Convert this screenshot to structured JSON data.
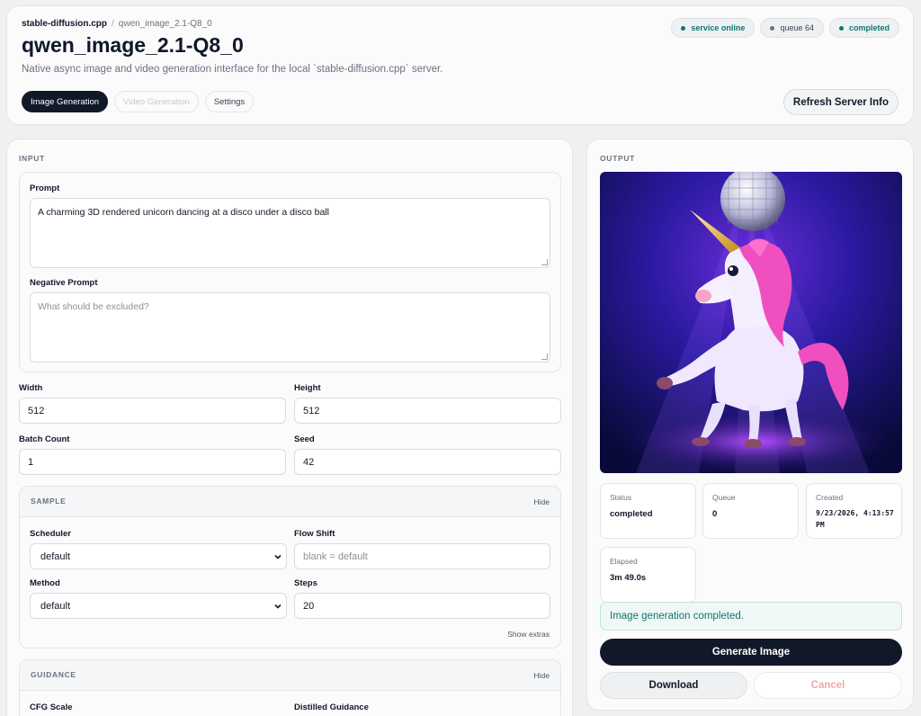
{
  "breadcrumb": {
    "project": "stable-diffusion.cpp",
    "model": "qwen_image_2.1-Q8_0"
  },
  "header": {
    "title": "qwen_image_2.1-Q8_0",
    "subtitle": "Native async image and video generation interface for the local `stable-diffusion.cpp` server.",
    "refresh_label": "Refresh Server Info"
  },
  "badges": [
    {
      "label": "service online",
      "dot_color": "#0f766e"
    },
    {
      "label": "queue 64",
      "dot_color": "#6b7280"
    },
    {
      "label": "completed",
      "dot_color": "#0f766e"
    }
  ],
  "tabs": [
    {
      "label": "Image Generation",
      "state": "active"
    },
    {
      "label": "Video Generation",
      "state": "disabled"
    },
    {
      "label": "Settings",
      "state": "normal"
    }
  ],
  "input": {
    "section_label": "INPUT",
    "prompt_label": "Prompt",
    "prompt_value": "A charming 3D rendered unicorn dancing at a disco under a disco ball",
    "negative_label": "Negative Prompt",
    "negative_placeholder": "What should be excluded?",
    "width_label": "Width",
    "width_value": "512",
    "height_label": "Height",
    "height_value": "512",
    "batch_label": "Batch Count",
    "batch_value": "1",
    "seed_label": "Seed",
    "seed_value": "42"
  },
  "sample": {
    "title": "SAMPLE",
    "hide_label": "Hide",
    "scheduler_label": "Scheduler",
    "scheduler_value": "default",
    "flow_shift_label": "Flow Shift",
    "flow_shift_placeholder": "blank = default",
    "method_label": "Method",
    "method_value": "default",
    "steps_label": "Steps",
    "steps_value": "20",
    "show_extras": "Show extras"
  },
  "guidance": {
    "title": "GUIDANCE",
    "hide_label": "Hide",
    "cfg_label": "CFG Scale",
    "distilled_label": "Distilled Guidance"
  },
  "output": {
    "section_label": "OUTPUT",
    "stats": [
      {
        "label": "Status",
        "value": "completed"
      },
      {
        "label": "Queue",
        "value": "0"
      },
      {
        "label": "Created",
        "value": "9/23/2026, 4:13:57 PM"
      },
      {
        "label": "Elapsed",
        "value": "3m 49.0s"
      }
    ],
    "alert": "Image generation completed.",
    "generate_label": "Generate Image",
    "download_label": "Download",
    "cancel_label": "Cancel"
  },
  "colors": {
    "primary": "#111827",
    "accent": "#0f766e",
    "cancel": "#f1a9a9"
  }
}
